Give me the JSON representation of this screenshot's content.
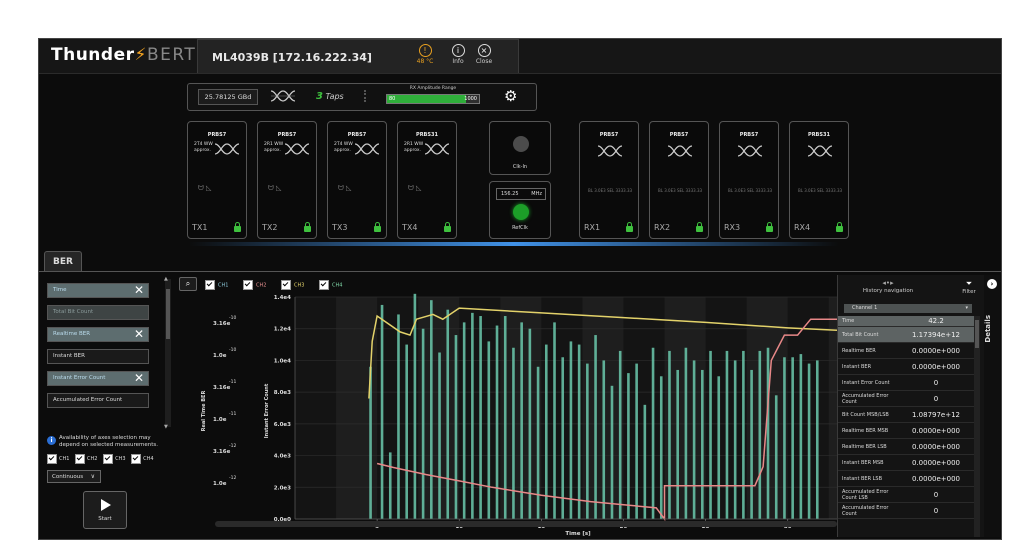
{
  "app": {
    "logo_part1": "Thunder",
    "logo_part2": "BERT",
    "device": "ML4039B  [172.16.222.34]",
    "temperature": "48 °C",
    "info_label": "Info",
    "close_label": "Close"
  },
  "config": {
    "data_rate": "25.78125  GBd",
    "taps_count": "3",
    "taps_label": "Taps",
    "amplitude_label": "RX Amplitude Range",
    "amp_min": "80",
    "amp_max": "1000",
    "amp_level": 0.86
  },
  "tx": [
    {
      "pattern": "PRBS7",
      "info": "2T4 WW approx.",
      "name": "TX1"
    },
    {
      "pattern": "PRBS7",
      "info": "2R1 WW approx.",
      "name": "TX2"
    },
    {
      "pattern": "PRBS7",
      "info": "2T4 WW approx.",
      "name": "TX3"
    },
    {
      "pattern": "PRBS31",
      "info": "2R1 WW approx.",
      "name": "TX4"
    }
  ],
  "clock": {
    "in_label": "Clk-In",
    "freq_value": "156.25",
    "freq_unit": "MHz",
    "out_label": "RefClk"
  },
  "rx": [
    {
      "pattern": "PRBS7",
      "info": "BL  3.0E3  SEL  3333.33",
      "name": "RX1"
    },
    {
      "pattern": "PRBS7",
      "info": "BL  3.0E3  SEL  3333.33",
      "name": "RX2"
    },
    {
      "pattern": "PRBS7",
      "info": "BL  3.0E3  SEL  3333.33",
      "name": "RX3"
    },
    {
      "pattern": "PRBS31",
      "info": "BL  3.0E3  SEL  3333.33",
      "name": "RX4"
    }
  ],
  "tab": "BER",
  "left": {
    "items": [
      {
        "label": "Time",
        "state": "sel",
        "removable": true
      },
      {
        "label": "Total Bit Count",
        "state": "dim",
        "removable": false
      },
      {
        "label": "Realtime BER",
        "state": "sel",
        "removable": true
      },
      {
        "label": "Instant BER",
        "state": "normal",
        "removable": false
      },
      {
        "label": "Instant Error Count",
        "state": "sel",
        "removable": true
      },
      {
        "label": "Accumulated Error Count",
        "state": "normal",
        "removable": false
      }
    ],
    "info_text": "Availability of axes selection may depend on selected measurements.",
    "channels": [
      "CH1",
      "CH2",
      "CH3",
      "CH4"
    ],
    "mode": "Continuous",
    "start_label": "Start"
  },
  "chart": {
    "legend": [
      "CH1",
      "CH2",
      "CH3",
      "CH4"
    ],
    "left_axis_label": "Real Time BER",
    "right_axis_label": "Instant Error Count",
    "x_label": "Time [s]",
    "ber_ticks": [
      {
        "m": "3.16e",
        "e": "-10"
      },
      {
        "m": "1.0e",
        "e": "-10"
      },
      {
        "m": "3.16e",
        "e": "-11"
      },
      {
        "m": "1.0e",
        "e": "-11"
      },
      {
        "m": "3.16e",
        "e": "-12"
      },
      {
        "m": "1.0e",
        "e": "-12"
      }
    ]
  },
  "chart_data": {
    "type": "bar",
    "x_label": "Time [s]",
    "x_ticks": [
      5,
      10,
      15,
      20,
      25,
      30
    ],
    "xlim": [
      0,
      33
    ],
    "y_right_label": "Instant Error Count",
    "y_right_ticks": [
      "0.0e0",
      "2.0e3",
      "4.0e3",
      "6.0e3",
      "8.0e3",
      "1.0e4",
      "1.2e4",
      "1.4e4"
    ],
    "y_right_lim": [
      0,
      14000
    ],
    "y_left_label": "Real Time BER",
    "y_left_log": true,
    "bars": [
      {
        "x": 4.6,
        "v": 9600
      },
      {
        "x": 5.3,
        "v": 13500
      },
      {
        "x": 5.8,
        "v": 4200
      },
      {
        "x": 6.3,
        "v": 12900
      },
      {
        "x": 6.8,
        "v": 11000
      },
      {
        "x": 7.3,
        "v": 14200
      },
      {
        "x": 7.8,
        "v": 12000
      },
      {
        "x": 8.3,
        "v": 13800
      },
      {
        "x": 8.8,
        "v": 10500
      },
      {
        "x": 9.3,
        "v": 13200
      },
      {
        "x": 9.8,
        "v": 11600
      },
      {
        "x": 10.3,
        "v": 12400
      },
      {
        "x": 10.8,
        "v": 13000
      },
      {
        "x": 11.3,
        "v": 12800
      },
      {
        "x": 11.8,
        "v": 11200
      },
      {
        "x": 12.3,
        "v": 12200
      },
      {
        "x": 12.8,
        "v": 12800
      },
      {
        "x": 13.3,
        "v": 10800
      },
      {
        "x": 13.8,
        "v": 12400
      },
      {
        "x": 14.3,
        "v": 12000
      },
      {
        "x": 14.8,
        "v": 9600
      },
      {
        "x": 15.3,
        "v": 11000
      },
      {
        "x": 15.8,
        "v": 12400
      },
      {
        "x": 16.3,
        "v": 10200
      },
      {
        "x": 16.8,
        "v": 11200
      },
      {
        "x": 17.3,
        "v": 11000
      },
      {
        "x": 17.8,
        "v": 9800
      },
      {
        "x": 18.3,
        "v": 11600
      },
      {
        "x": 18.8,
        "v": 10000
      },
      {
        "x": 19.3,
        "v": 8400
      },
      {
        "x": 19.8,
        "v": 10600
      },
      {
        "x": 20.3,
        "v": 9200
      },
      {
        "x": 20.8,
        "v": 9800
      },
      {
        "x": 21.3,
        "v": 7200
      },
      {
        "x": 21.8,
        "v": 10800
      },
      {
        "x": 22.3,
        "v": 9000
      },
      {
        "x": 22.8,
        "v": 10600
      },
      {
        "x": 23.3,
        "v": 9400
      },
      {
        "x": 23.8,
        "v": 10800
      },
      {
        "x": 24.3,
        "v": 10000
      },
      {
        "x": 24.8,
        "v": 9400
      },
      {
        "x": 25.3,
        "v": 10600
      },
      {
        "x": 25.8,
        "v": 9000
      },
      {
        "x": 26.3,
        "v": 10600
      },
      {
        "x": 26.8,
        "v": 10000
      },
      {
        "x": 27.3,
        "v": 10600
      },
      {
        "x": 27.8,
        "v": 9400
      },
      {
        "x": 28.3,
        "v": 10600
      },
      {
        "x": 28.8,
        "v": 10800
      },
      {
        "x": 29.3,
        "v": 7800
      },
      {
        "x": 29.8,
        "v": 10200
      },
      {
        "x": 30.3,
        "v": 10200
      },
      {
        "x": 30.8,
        "v": 10400
      },
      {
        "x": 31.3,
        "v": 9800
      },
      {
        "x": 31.8,
        "v": 10000
      }
    ],
    "series": [
      {
        "color": "#e3d26a",
        "points": [
          [
            4.5,
            7600
          ],
          [
            4.7,
            11200
          ],
          [
            5.0,
            12800
          ],
          [
            6.4,
            11800
          ],
          [
            7.0,
            11600
          ],
          [
            7.4,
            12600
          ],
          [
            8.4,
            12900
          ],
          [
            9.0,
            12600
          ],
          [
            10.0,
            13300
          ],
          [
            15.0,
            13000
          ],
          [
            20.0,
            12700
          ],
          [
            25.0,
            12400
          ],
          [
            30.0,
            12050
          ],
          [
            33.0,
            11900
          ]
        ]
      },
      {
        "color": "#e88888",
        "points": [
          [
            5.0,
            3500
          ],
          [
            6.0,
            3250
          ],
          [
            8.0,
            2800
          ],
          [
            10.0,
            2400
          ],
          [
            12.0,
            2000
          ],
          [
            15.0,
            1500
          ],
          [
            18.0,
            1100
          ],
          [
            20.0,
            900
          ],
          [
            22.0,
            700
          ],
          [
            22.5,
            0
          ],
          [
            22.5,
            2100
          ],
          [
            25.0,
            2100
          ],
          [
            28.0,
            2100
          ],
          [
            28.5,
            3300
          ],
          [
            29.0,
            10000
          ],
          [
            29.8,
            11600
          ],
          [
            30.6,
            11600
          ],
          [
            31.4,
            12600
          ],
          [
            33.0,
            12600
          ]
        ]
      }
    ]
  },
  "details": {
    "tab_label": "Details",
    "history_label": "History navigation",
    "filter_label": "Filter",
    "channel": "Channel 1",
    "rows": [
      {
        "label": "Time",
        "value": "42.2",
        "hl": true
      },
      {
        "label": "Total Bit Count",
        "value": "1.17394e+12",
        "hl": true
      },
      {
        "label": "Realtime BER",
        "value": "0.0000e+000",
        "hl": false
      },
      {
        "label": "Instant BER",
        "value": "0.0000e+000",
        "hl": false
      },
      {
        "label": "Instant Error Count",
        "value": "0",
        "hl": false
      },
      {
        "label": "Accumulated Error Count",
        "value": "0",
        "hl": false
      },
      {
        "label": "Bit Count MSB/LSB",
        "value": "1.08797e+12",
        "hl": false
      },
      {
        "label": "Realtime BER MSB",
        "value": "0.0000e+000",
        "hl": false
      },
      {
        "label": "Realtime BER LSB",
        "value": "0.0000e+000",
        "hl": false
      },
      {
        "label": "Instant BER MSB",
        "value": "0.0000e+000",
        "hl": false
      },
      {
        "label": "Instant BER LSB",
        "value": "0.0000e+000",
        "hl": false
      },
      {
        "label": "Accumulated Error Count LSB",
        "value": "0",
        "hl": false
      },
      {
        "label": "Accumulated Error Count",
        "value": "0",
        "hl": false
      }
    ]
  }
}
